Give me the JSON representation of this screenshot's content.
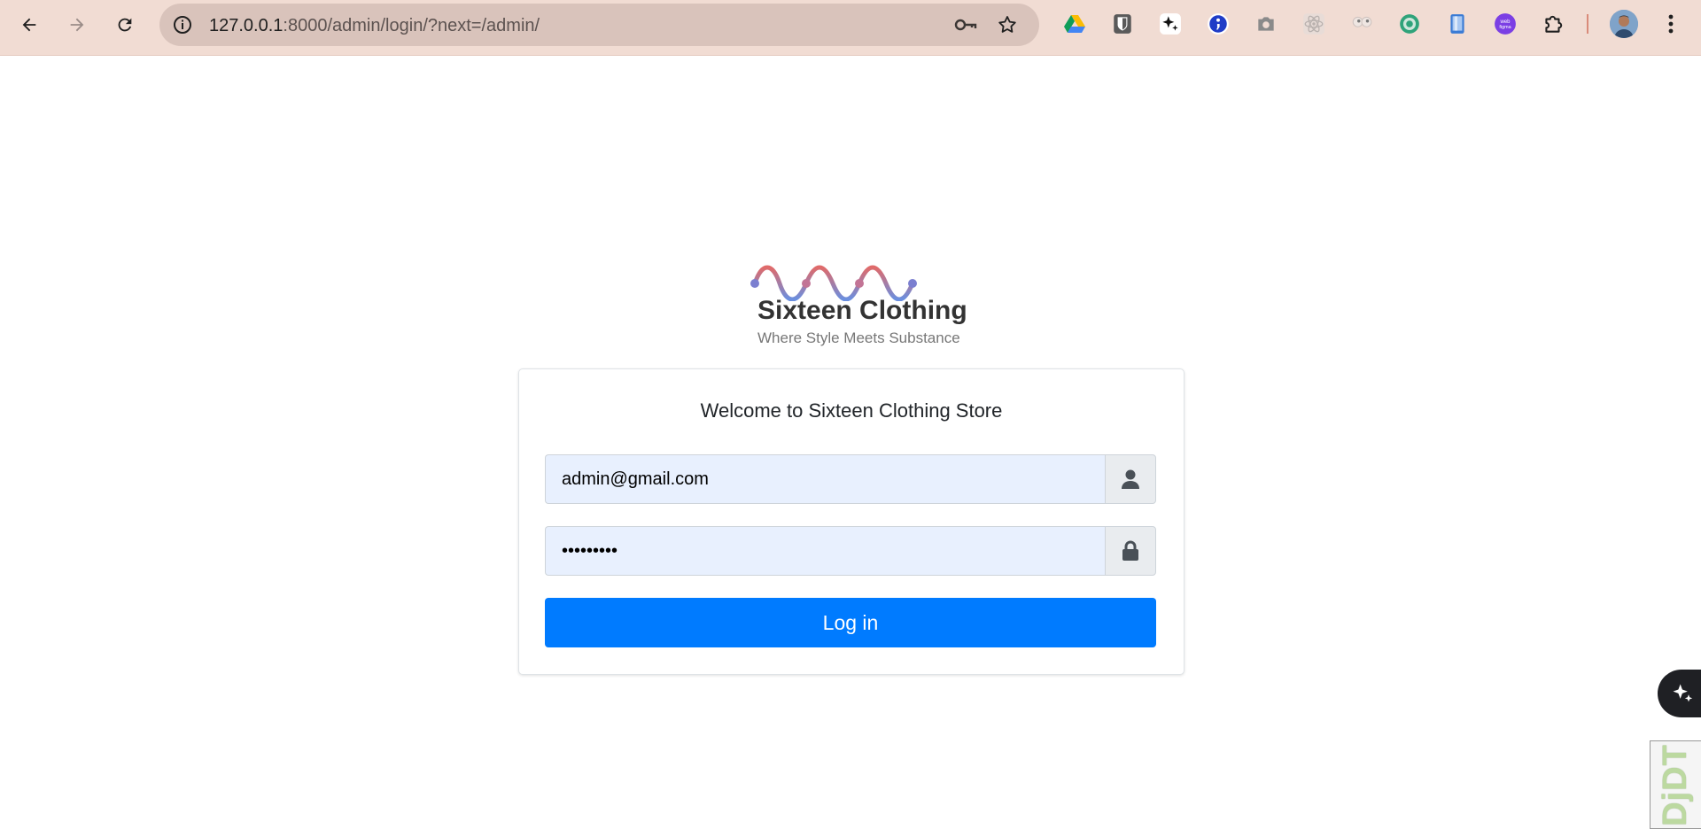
{
  "browser": {
    "url_host": "127.0.0.1",
    "url_rest": ":8000/admin/login/?next=/admin/",
    "extensions": [
      "google-drive-icon",
      "bitwarden-icon",
      "ai-sparkle-icon",
      "semicolon-icon",
      "camera-icon",
      "react-icon",
      "eyes-icon",
      "green-circle-icon",
      "phone-icon",
      "web-figma-icon",
      "puzzle-extensions-icon"
    ]
  },
  "brand": {
    "name": "Sixteen Clothing",
    "tagline": "Where Style Meets Substance",
    "colors": {
      "wave_start": "#e06a6a",
      "wave_end": "#6a8fe0"
    }
  },
  "login": {
    "title": "Welcome to Sixteen Clothing Store",
    "username_value": "admin@gmail.com",
    "password_value": "adminpass",
    "submit_label": "Log in",
    "accent": "#007bff"
  },
  "widgets": {
    "debug_toolbar_label": "DjDT"
  }
}
